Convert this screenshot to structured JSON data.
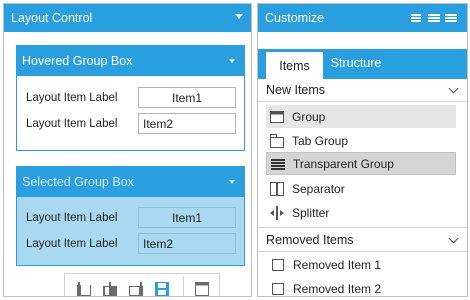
{
  "layout_panel": {
    "title": "Layout Control",
    "hovered_group": {
      "title": "Hovered Group Box",
      "rows": [
        {
          "label": "Layout Item Label",
          "value": "Item1"
        },
        {
          "label": "Layout Item Label",
          "value": "Item2"
        }
      ]
    },
    "selected_group": {
      "title": "Selected Group Box",
      "rows": [
        {
          "label": "Layout Item Label",
          "value": "Item1"
        },
        {
          "label": "Layout Item Label",
          "value": "Item2"
        }
      ]
    },
    "toolbar_icons": [
      "align-left-icon",
      "align-center-icon",
      "align-right-icon",
      "save-icon",
      "maximize-icon"
    ]
  },
  "customize_panel": {
    "title": "Customize",
    "tabs": [
      {
        "label": "Items",
        "active": true
      },
      {
        "label": "Structure",
        "active": false
      }
    ],
    "new_items": {
      "title": "New Items",
      "items": [
        {
          "label": "Group",
          "icon": "group-icon"
        },
        {
          "label": "Tab Group",
          "icon": "tab-group-icon"
        },
        {
          "label": "Transparent Group",
          "icon": "transparent-group-icon"
        },
        {
          "label": "Separator",
          "icon": "separator-icon"
        },
        {
          "label": "Splitter",
          "icon": "splitter-icon"
        }
      ]
    },
    "removed_items": {
      "title": "Removed Items",
      "items": [
        {
          "label": "Removed Item 1"
        },
        {
          "label": "Removed Item 2"
        }
      ]
    }
  },
  "colors": {
    "accent": "#2a9fdf",
    "selected_fill": "#a8d9f0"
  }
}
